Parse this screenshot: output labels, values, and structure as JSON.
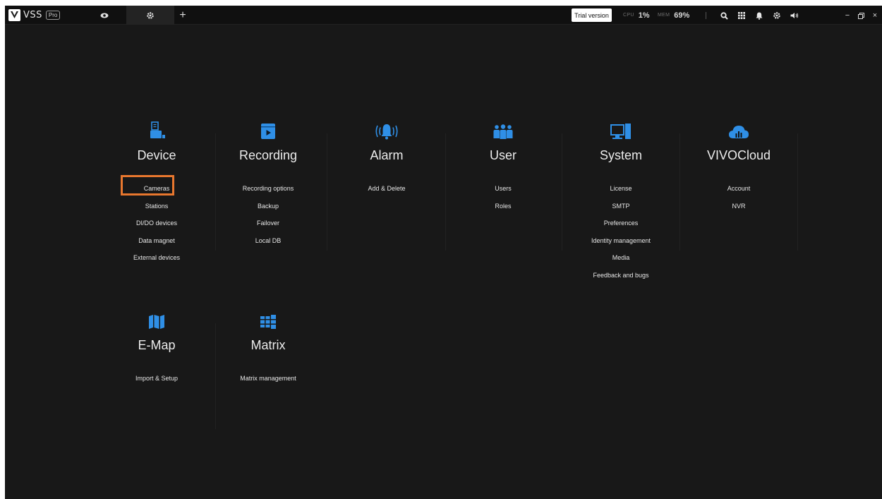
{
  "app": {
    "name": "VSS",
    "badge": "Pro",
    "colors": {
      "accent": "#2f8fe6",
      "highlight": "#e8772e",
      "background": "#181818"
    }
  },
  "tabs": [
    {
      "name": "live-view",
      "icon": "eye-icon"
    },
    {
      "name": "settings",
      "icon": "gear-icon",
      "active": true
    },
    {
      "name": "add",
      "icon": "plus-icon",
      "label": "+"
    }
  ],
  "status": {
    "trial_label": "Trial version",
    "cpu_label": "CPU",
    "cpu_value": "1%",
    "mem_label": "MEM",
    "mem_value": "69%"
  },
  "toolbar_icons": [
    "search-icon",
    "apps-grid-icon",
    "bell-icon",
    "gear-icon",
    "speaker-icon",
    "minimize-icon",
    "restore-icon",
    "close-icon"
  ],
  "window_controls": {
    "minimize": "−",
    "close": "×"
  },
  "categories": {
    "device": {
      "title": "Device",
      "icon": "device-icon",
      "items": [
        "Cameras",
        "Stations",
        "DI/DO devices",
        "Data magnet",
        "External devices"
      ],
      "highlighted": "Cameras"
    },
    "recording": {
      "title": "Recording",
      "icon": "recording-icon",
      "items": [
        "Recording options",
        "Backup",
        "Failover",
        "Local DB"
      ]
    },
    "alarm": {
      "title": "Alarm",
      "icon": "alarm-bell-icon",
      "items": [
        "Add & Delete"
      ]
    },
    "user": {
      "title": "User",
      "icon": "users-group-icon",
      "items": [
        "Users",
        "Roles"
      ]
    },
    "system": {
      "title": "System",
      "icon": "computer-icon",
      "items": [
        "License",
        "SMTP",
        "Preferences",
        "Identity management",
        "Media",
        "Feedback and bugs"
      ]
    },
    "vivocloud": {
      "title": "VIVOCloud",
      "icon": "cloud-icon",
      "items": [
        "Account",
        "NVR"
      ]
    },
    "emap": {
      "title": "E-Map",
      "icon": "map-icon",
      "items": [
        "Import & Setup"
      ]
    },
    "matrix": {
      "title": "Matrix",
      "icon": "matrix-grid-icon",
      "items": [
        "Matrix management"
      ]
    }
  }
}
